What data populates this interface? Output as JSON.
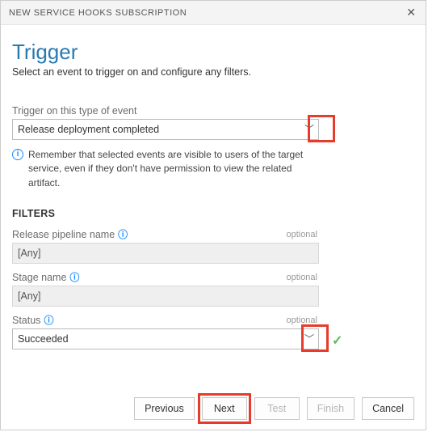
{
  "titlebar": {
    "title": "NEW SERVICE HOOKS SUBSCRIPTION"
  },
  "header": {
    "heading": "Trigger",
    "subtext": "Select an event to trigger on and configure any filters."
  },
  "event": {
    "label": "Trigger on this type of event",
    "value": "Release deployment completed"
  },
  "info_note": "Remember that selected events are visible to users of the target service, even if they don't have permission to view the related artifact.",
  "filters": {
    "heading": "FILTERS",
    "optional_label": "optional",
    "pipeline": {
      "label": "Release pipeline name",
      "value": "[Any]"
    },
    "stage": {
      "label": "Stage name",
      "value": "[Any]"
    },
    "status": {
      "label": "Status",
      "value": "Succeeded"
    }
  },
  "buttons": {
    "previous": "Previous",
    "next": "Next",
    "test": "Test",
    "finish": "Finish",
    "cancel": "Cancel"
  }
}
